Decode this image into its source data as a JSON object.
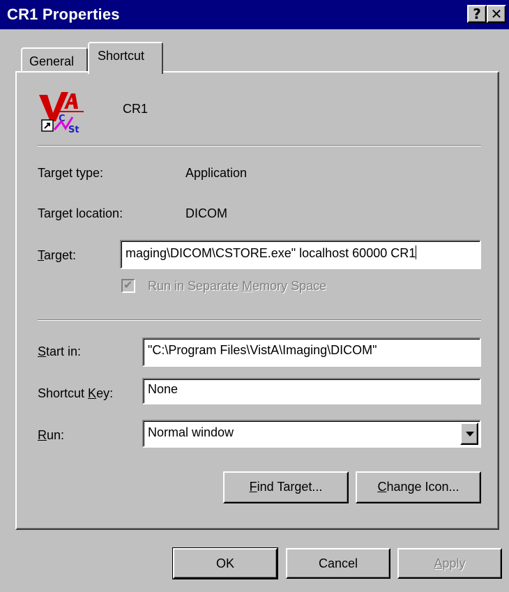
{
  "window": {
    "title": "CR1 Properties",
    "help_glyph": "?",
    "close_glyph": "✕"
  },
  "tabs": [
    {
      "label": "General",
      "active": false
    },
    {
      "label": "Shortcut",
      "active": true
    }
  ],
  "shortcut": {
    "name": "CR1",
    "icon": "vista-cstore-icon",
    "target_type_label": "Target type:",
    "target_type_value": "Application",
    "target_location_label": "Target location:",
    "target_location_value": "DICOM",
    "target_label_u": "T",
    "target_label_rest": "arget:",
    "target_value": "maging\\DICOM\\CSTORE.exe\" localhost 60000 CR1",
    "separate_memory": {
      "pre": "Run in Separate ",
      "u": "M",
      "post": "emory Space",
      "checked": true,
      "enabled": false
    },
    "start_in_label_u": "S",
    "start_in_label_rest": "tart in:",
    "start_in_value": "\"C:\\Program Files\\VistA\\Imaging\\DICOM\"",
    "shortcut_key_label_pre": "Shortcut ",
    "shortcut_key_label_u": "K",
    "shortcut_key_label_post": "ey:",
    "shortcut_key_value": "None",
    "run_label_u": "R",
    "run_label_rest": "un:",
    "run_value": "Normal window",
    "find_target_u": "F",
    "find_target_rest": "ind Target...",
    "change_icon_u": "C",
    "change_icon_rest": "hange Icon..."
  },
  "footer": {
    "ok": "OK",
    "cancel": "Cancel",
    "apply_u": "A",
    "apply_rest": "pply"
  }
}
